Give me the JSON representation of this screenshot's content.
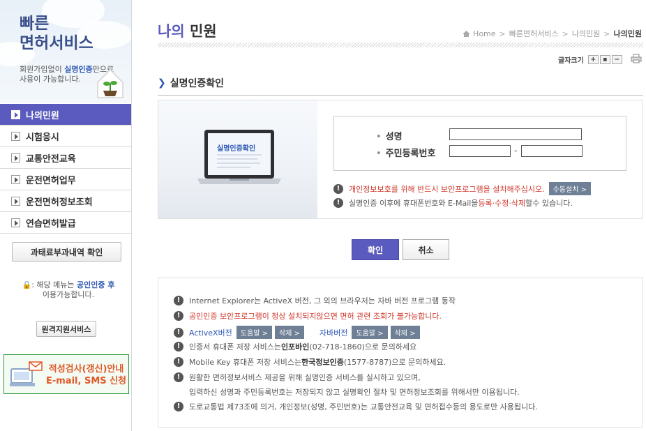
{
  "sidebar": {
    "title_line1": "빠른",
    "title_line2": "면허서비스",
    "desc_line1_pre": "회원가입없이 ",
    "desc_line1_bold": "실명인증",
    "desc_line1_post": "만으로",
    "desc_line2": "사용이 가능합니다.",
    "menu": [
      {
        "label": "나의민원",
        "active": true
      },
      {
        "label": "시험응시",
        "active": false
      },
      {
        "label": "교통안전교육",
        "active": false
      },
      {
        "label": "운전면허업무",
        "active": false
      },
      {
        "label": "운전면허정보조회",
        "active": false
      },
      {
        "label": "연습면허발급",
        "active": false
      }
    ],
    "fine_button": "과태료부과내역 확인",
    "lock_note_pre": ": 해당 메뉴는 ",
    "lock_note_bold": "공인인증 후",
    "lock_note_post": "이용가능합니다.",
    "remote_button": "원격지원서비스",
    "ad_line1": "적성검사(갱신)안내",
    "ad_line2": "E-mail, SMS 신청"
  },
  "header": {
    "title_accent": "나의",
    "title_rest": " 민원",
    "breadcrumb": [
      "Home",
      "빠른면허서비스",
      "나의민원",
      "나의민원"
    ],
    "fontsize_label": "글자크기",
    "fontsize_buttons": [
      "+",
      "■",
      "−"
    ]
  },
  "section": {
    "title": "실명인증확인"
  },
  "verify": {
    "screen_title": "실명인증확인",
    "name_label": "성명",
    "rrn_label": "주민등록번호",
    "name_value": "",
    "rrn_front_value": "",
    "rrn_back_value": "",
    "rrn_dash": "-",
    "warn1": "개인정보보호를 위해 반드시 보안프로그램을 설치해주십시오.",
    "warn1_button": "수동설치 >",
    "warn2_pre": "실명인증 이후에 휴대폰번호와 E-Mail을 ",
    "warn2_link": "등록·수정·삭제",
    "warn2_post": "할수 있습니다."
  },
  "buttons": {
    "confirm": "확인",
    "cancel": "취소"
  },
  "notices": {
    "n1": "Internet Explorer는 ActiveX 버전, 그 외의 브라우저는 자바 버전 프로그램 동작",
    "n2": "공인인증 보안프로그램이 정상 설치되지않으면 면허 관련 조회가 불가능합니다.",
    "n3_activex": "ActiveX버전",
    "n3_java": "자바버전",
    "n3_help": "도움말 >",
    "n3_delete": "삭제 >",
    "n4_pre": "인증서 휴대폰 저장 서비스는 ",
    "n4_bold": "인포바인",
    "n4_post": "(02-718-1860)으로 문의하세요",
    "n5_pre": "Mobile Key 휴대폰 저장 서비스는 ",
    "n5_bold": "한국정보인증",
    "n5_post": "(1577-8787)으로 문의하세요.",
    "n6_line1": "원활한 면허정보서비스 제공을 위해 실명인증 서비스를 실시하고 있으며,",
    "n6_line2": "입력하신 성명과 주민등록번호는 저장되지 않고 실명확인 절차 및 면허정보조회를 위해서만 이용됩니다.",
    "n7": "도로교통법 제73조에 의거, 개인정보(성명, 주민번호)는 교통안전교육 및 면허접수등의 용도로만 사용됩니다."
  }
}
